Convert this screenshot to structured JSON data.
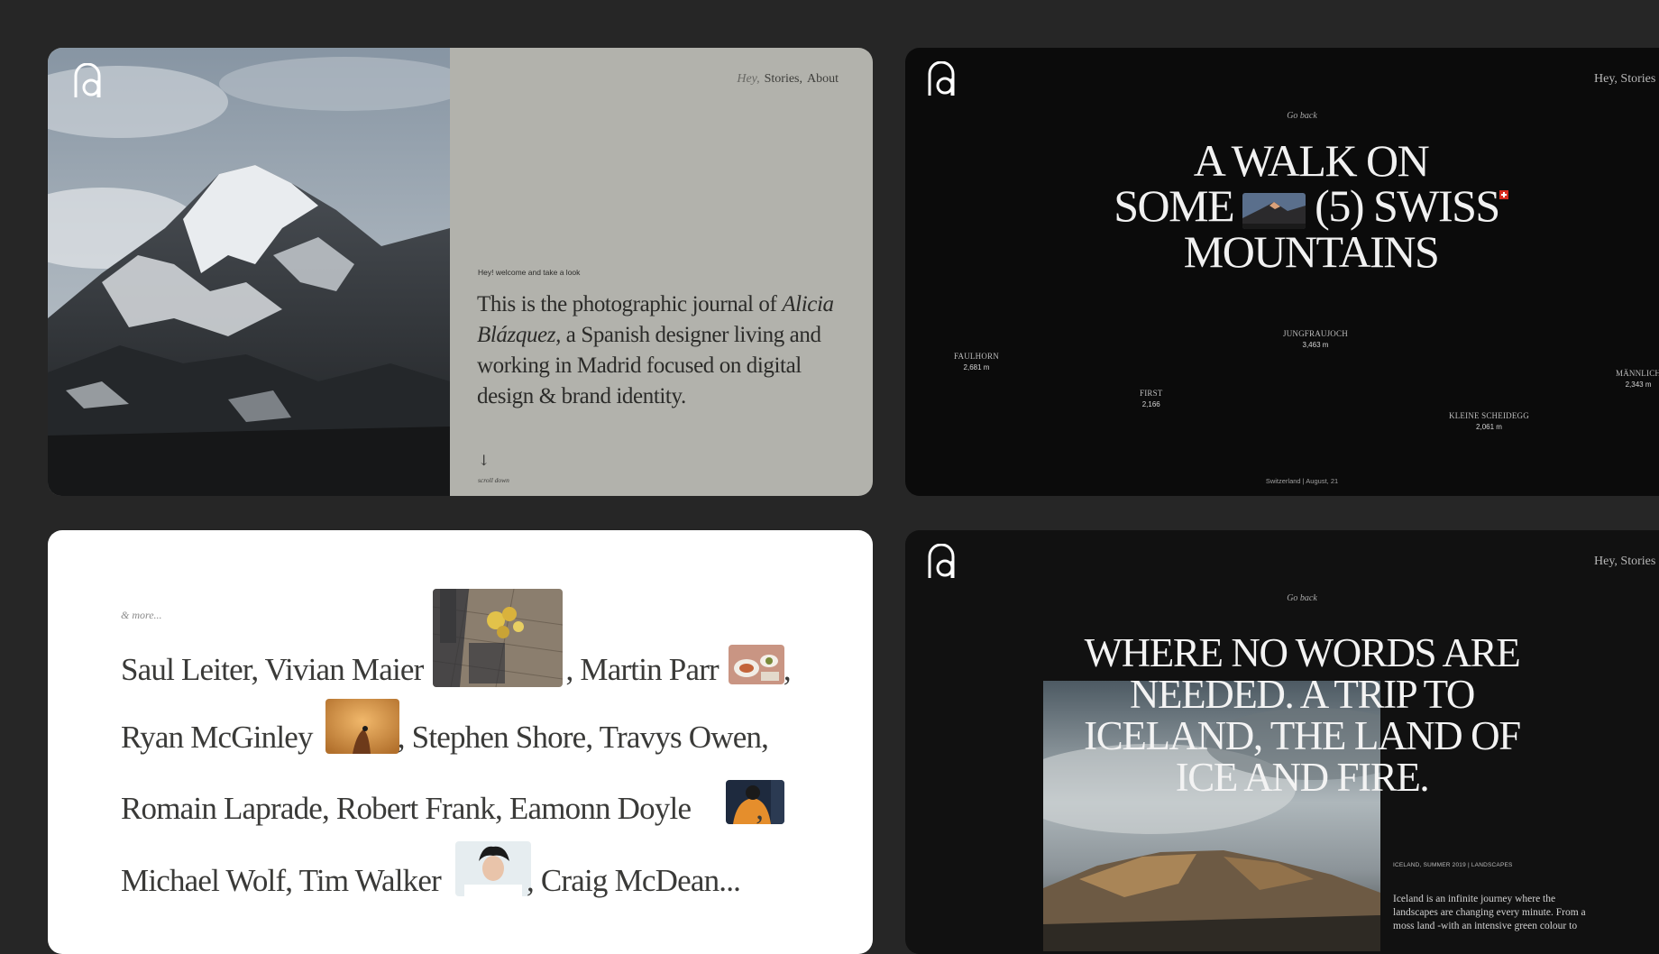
{
  "home": {
    "nav": {
      "hey": "Hey,",
      "stories": "Stories,",
      "about": "About"
    },
    "label": "Hey! welcome and take a look",
    "intro_pre": "This is the photographic journal of ",
    "intro_name": "Alicia Blázquez,",
    "intro_post": " a Spanish designer living and working in Madrid focused on digital design & brand identity.",
    "arrow": "↓",
    "scroll_label": "scroll down"
  },
  "walk": {
    "nav": "Hey, Stories",
    "goback": "Go back",
    "title_line1": "A WALK ON",
    "title_line2a": "SOME",
    "title_line2b": "(5) SWISS",
    "title_line3": "MOUNTAINS",
    "peaks": [
      {
        "name": "FAULHORN",
        "height": "2,681 m"
      },
      {
        "name": "JUNGFRAUJOCH",
        "height": "3,463 m"
      },
      {
        "name": "FIRST",
        "height": "2,166"
      },
      {
        "name": "KLEINE SCHEIDEGG",
        "height": "2,061 m"
      },
      {
        "name": "MÄNNLICH",
        "height": "2,343 m"
      }
    ],
    "footer": "Switzerland | August, 21"
  },
  "more": {
    "label": "& more...",
    "line1a": "Saul Leiter, Vivian Maier",
    "line1b": ", Martin Parr",
    "line1c": ",",
    "line2a": "Ryan McGinley",
    "line2b": ", Stephen Shore, Travys Owen,",
    "line3a": "Romain Laprade, Robert Frank, Eamonn Doyle",
    "line3b": ",",
    "line4a": "Michael Wolf, Tim Walker",
    "line4b": ", Craig McDean..."
  },
  "iceland": {
    "nav": "Hey, Stories",
    "goback": "Go back",
    "title_l1": "WHERE NO WORDS  ARE",
    "title_l2": "NEEDED. A TRIP TO",
    "title_l3": "ICELAND, THE LAND OF",
    "title_l4": "ICE AND FIRE.",
    "meta": "ICELAND, SUMMER 2019   |   LANDSCAPES",
    "text": "Iceland is  an infinite journey where the landscapes are changing every minute. From a moss land -with an intensive green colour to"
  },
  "colors": {
    "page_bg": "#262626",
    "home_panel": "#b2b2ac",
    "dark_card": "#0b0b0b",
    "light_card": "#ffffff"
  }
}
